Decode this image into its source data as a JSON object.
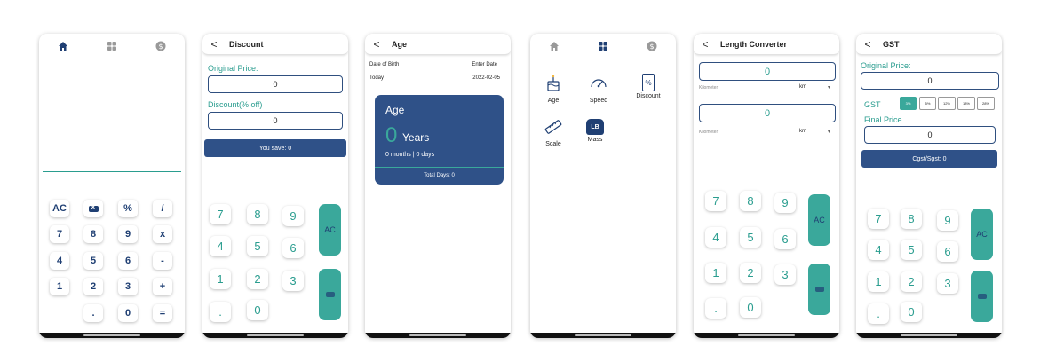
{
  "calculator": {
    "keys": [
      "AC",
      "⌫",
      "%",
      "/",
      "7",
      "8",
      "9",
      "x",
      "4",
      "5",
      "6",
      "-",
      "1",
      "2",
      "3",
      "+",
      ".",
      "0",
      "="
    ],
    "nav_icons": [
      "home-icon",
      "grid-icon",
      "dollar-icon"
    ]
  },
  "discount": {
    "title": "Discount",
    "back": "<",
    "original_price_label": "Original Price:",
    "original_price_value": "0",
    "discount_label": "Discount(% off)",
    "discount_value": "0",
    "you_save": "You save: 0",
    "keys": [
      "7",
      "8",
      "9",
      "4",
      "5",
      "6",
      "1",
      "2",
      "3",
      ".",
      "0"
    ],
    "ac_label": "AC"
  },
  "age": {
    "title": "Age",
    "back": "<",
    "dob_label": "Date of Birth",
    "dob_value": "Enter Date",
    "today_label": "Today",
    "today_value": "2022-02-05",
    "card_title": "Age",
    "years_value": "0",
    "years_label": "Years",
    "months_days": "0 months | 0 days",
    "total_days": "Total Days: 0"
  },
  "menu": {
    "nav_icons": [
      "home-icon",
      "grid-icon",
      "dollar-icon"
    ],
    "items": [
      {
        "label": "Age",
        "icon": "cake-icon"
      },
      {
        "label": "Speed",
        "icon": "speedometer-icon"
      },
      {
        "label": "Discount",
        "icon": "discount-tag-icon"
      },
      {
        "label": "Scale",
        "icon": "ruler-icon"
      },
      {
        "label": "Mass",
        "icon": "weight-icon"
      }
    ],
    "mass_badge": "LB",
    "discount_badge": "%"
  },
  "length": {
    "title": "Length Converter",
    "back": "<",
    "input1_value": "0",
    "unit1_name": "Kilometer",
    "unit1_abbr": "km",
    "input2_value": "0",
    "unit2_name": "Kilometer",
    "unit2_abbr": "km",
    "keys": [
      "7",
      "8",
      "9",
      "4",
      "5",
      "6",
      "1",
      "2",
      "3",
      ".",
      "0"
    ],
    "ac_label": "AC"
  },
  "gst": {
    "title": "GST",
    "back": "<",
    "original_price_label": "Original Price:",
    "original_price_value": "0",
    "gst_label": "GST",
    "rates": [
      "3%",
      "5%",
      "12%",
      "18%",
      "28%"
    ],
    "final_price_label": "Final Price",
    "final_price_value": "0",
    "cgst": "Cgst/Sgst: 0",
    "keys": [
      "7",
      "8",
      "9",
      "4",
      "5",
      "6",
      "1",
      "2",
      "3",
      ".",
      "0"
    ],
    "ac_label": "AC"
  },
  "colors": {
    "navy": "#2f5188",
    "teal": "#3aa89b",
    "text_teal": "#2a9d8f"
  }
}
